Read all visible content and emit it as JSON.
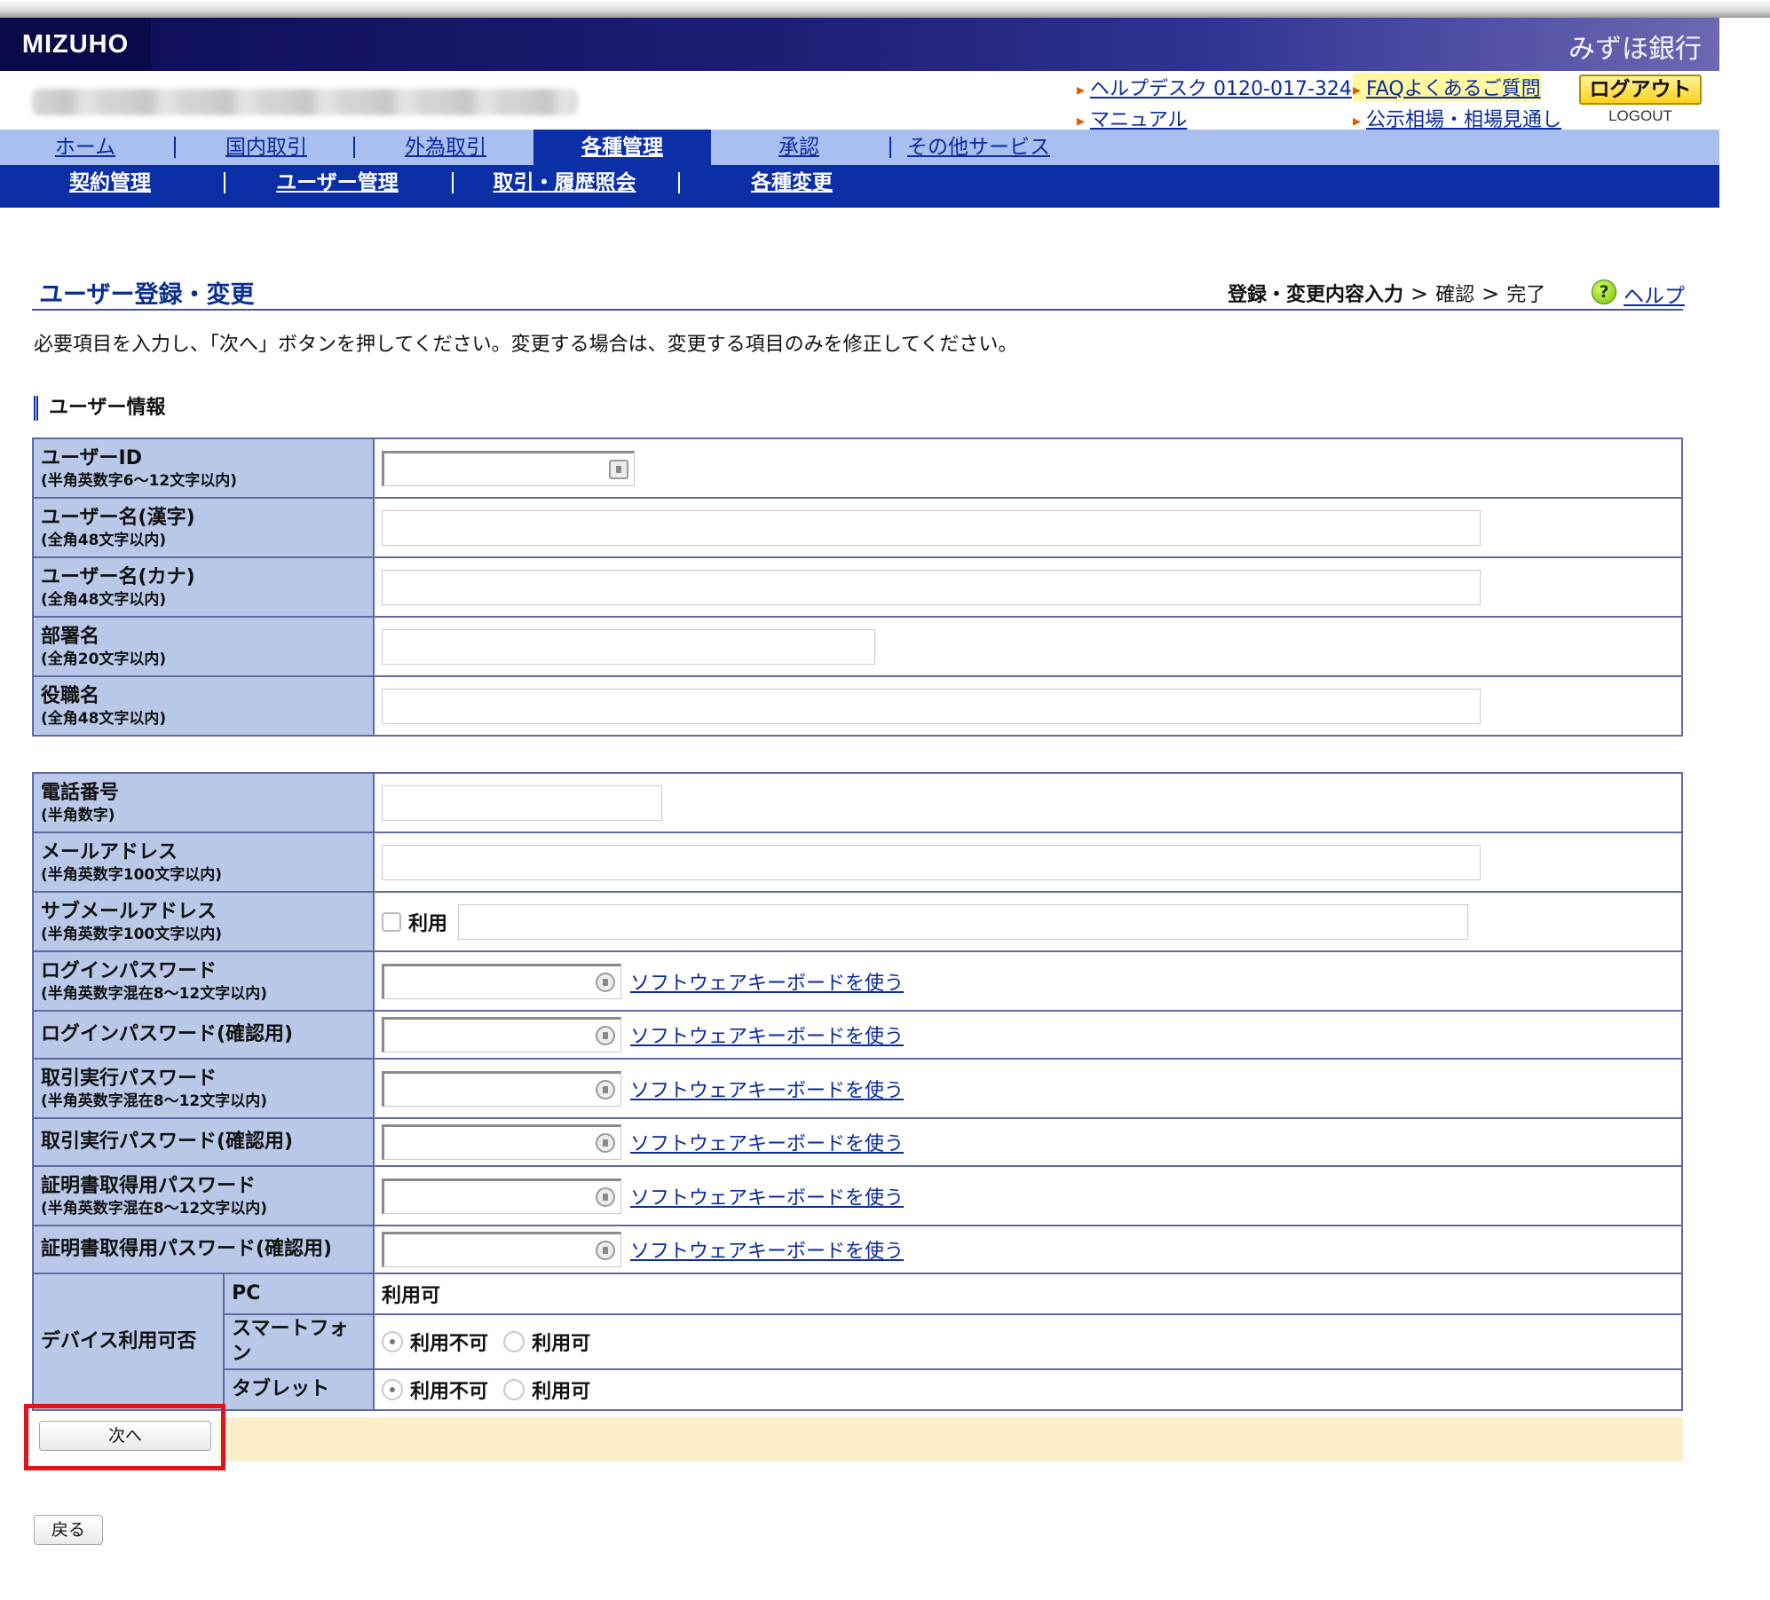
{
  "header": {
    "logo_text": "MIZUHO",
    "bank_name": "みずほ銀行",
    "links": {
      "helpdesk": "ヘルプデスク 0120-017-324",
      "faq": "FAQよくあるご質問",
      "manual": "マニュアル",
      "market": "公示相場・相場見通し"
    },
    "logout_label": "ログアウト",
    "logout_sub": "LOGOUT"
  },
  "main_nav": [
    "ホーム",
    "国内取引",
    "外為取引",
    "各種管理",
    "承認",
    "その他サービス"
  ],
  "main_nav_active": "各種管理",
  "sub_nav": [
    "契約管理",
    "ユーザー管理",
    "取引・履歴照会",
    "各種変更"
  ],
  "page": {
    "title": "ユーザー登録・変更",
    "steps": [
      "登録・変更内容入力",
      "確認",
      "完了"
    ],
    "steps_current": "登録・変更内容入力",
    "help_icon": "?",
    "help": "ヘルプ",
    "instruction": "必要項目を入力し、「次へ」ボタンを押してください。変更する場合は、変更する項目のみを修正してください。",
    "section_title": "ユーザー情報"
  },
  "user_fields": [
    {
      "label": "ユーザーID",
      "note": "(半角英数字6～12文字以内)",
      "value": ""
    },
    {
      "label": "ユーザー名(漢字)",
      "note": "(全角48文字以内)",
      "value": ""
    },
    {
      "label": "ユーザー名(カナ)",
      "note": "(全角48文字以内)",
      "value": ""
    },
    {
      "label": "部署名",
      "note": "(全角20文字以内)",
      "value": ""
    },
    {
      "label": "役職名",
      "note": "(全角48文字以内)",
      "value": ""
    }
  ],
  "contact_fields": [
    {
      "label": "電話番号",
      "note": "(半角数字)",
      "value": ""
    },
    {
      "label": "メールアドレス",
      "note": "(半角英数字100文字以内)",
      "value": ""
    },
    {
      "label": "サブメールアドレス",
      "note": "(半角英数字100文字以内)",
      "checkbox_label": "利用",
      "value": ""
    }
  ],
  "password_fields": [
    {
      "label": "ログインパスワード",
      "note": "(半角英数字混在8～12文字以内)"
    },
    {
      "label": "ログインパスワード(確認用)",
      "note": ""
    },
    {
      "label": "取引実行パスワード",
      "note": "(半角英数字混在8～12文字以内)"
    },
    {
      "label": "取引実行パスワード(確認用)",
      "note": ""
    },
    {
      "label": "証明書取得用パスワード",
      "note": "(半角英数字混在8～12文字以内)"
    },
    {
      "label": "証明書取得用パスワード(確認用)",
      "note": ""
    }
  ],
  "software_keyboard_link": "ソフトウェアキーボードを使う",
  "device": {
    "label": "デバイス利用可否",
    "rows": [
      {
        "name": "PC",
        "value": "利用可"
      },
      {
        "name": "スマートフォン",
        "options": [
          "利用不可",
          "利用可"
        ],
        "selected": "利用不可"
      },
      {
        "name": "タブレット",
        "options": [
          "利用不可",
          "利用可"
        ],
        "selected": "利用不可"
      }
    ]
  },
  "buttons": {
    "next": "次へ",
    "back": "戻る"
  },
  "colors": {
    "nav_active": "#0b2fa7",
    "nav_bg": "#a9bff0",
    "label_bg": "#b9c7e8",
    "highlight": "#e0141a",
    "next_bar": "#fcefcc"
  }
}
